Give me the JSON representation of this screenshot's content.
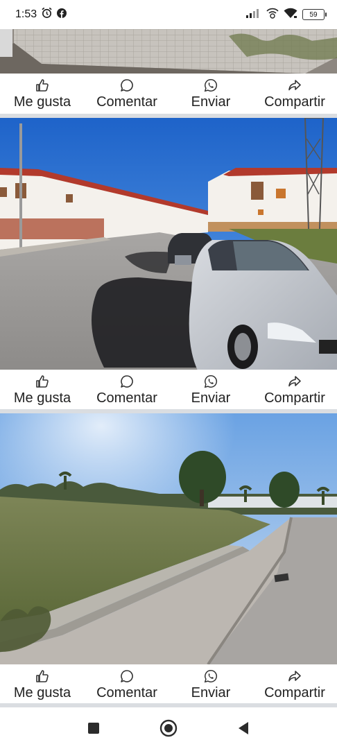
{
  "status_bar": {
    "time": "1:53",
    "battery": "59",
    "icons": [
      "alarm-icon",
      "facebook-icon",
      "signal-icon",
      "wifi-calling-icon",
      "wifi-icon",
      "battery-icon"
    ]
  },
  "posts": [
    {
      "like_label": "Me gusta",
      "comment_label": "Comentar",
      "send_label": "Enviar",
      "share_label": "Compartir"
    },
    {
      "like_label": "Me gusta",
      "comment_label": "Comentar",
      "send_label": "Enviar",
      "share_label": "Compartir"
    },
    {
      "like_label": "Me gusta",
      "comment_label": "Comentar",
      "send_label": "Enviar",
      "share_label": "Compartir"
    }
  ],
  "nav_bar": {
    "buttons": [
      "recent-apps-icon",
      "home-icon",
      "back-icon"
    ]
  },
  "colors": {
    "divider": "#dadde1",
    "icon": "#333333"
  }
}
